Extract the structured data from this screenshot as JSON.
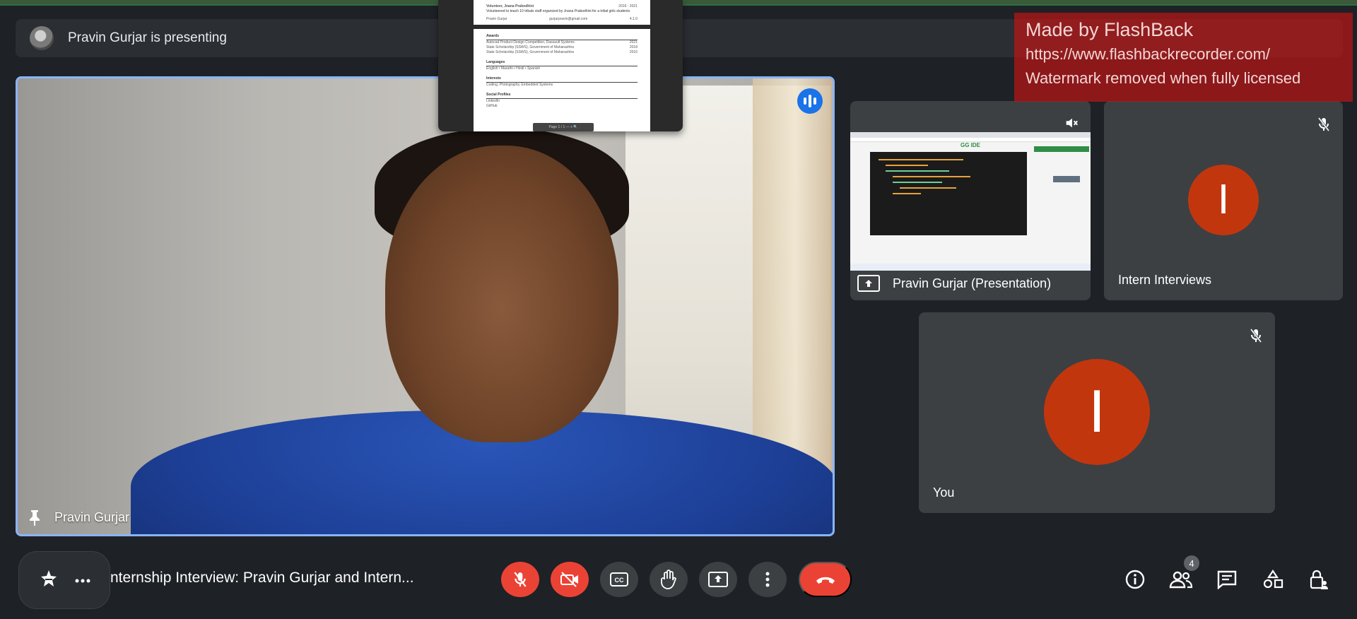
{
  "banner": {
    "text": "Pravin Gurjar is presenting"
  },
  "main_tile": {
    "name": "Pravin Gurjar"
  },
  "document_preview": {
    "activity_heading": "Volunteer, Jnana Prabodhini",
    "activity_line": "Volunteered to teach 10 tribals staff organized by Jnana Prabodhini for a tribal girls students",
    "activity_date": "2016 - 2021",
    "activity_contact": "Pravin Gurjar",
    "activity_email": "gurjarpravin@gmail.com",
    "activity_right": "4.1.0",
    "sections": [
      {
        "title": "Awards",
        "lines": [
          {
            "left": "Autocad Product Design Competition, Dassault Systems",
            "right": "2021"
          },
          {
            "left": "State Scholarship (SSWS), Government of Maharashtra",
            "right": "2018"
          },
          {
            "left": "State Scholarship (SSWS), Government of Maharashtra",
            "right": "2016"
          }
        ]
      },
      {
        "title": "Languages",
        "lines": [
          {
            "left": "English • Marathi • Hindi • Spanish",
            "right": ""
          }
        ]
      },
      {
        "title": "Interests",
        "lines": [
          {
            "left": "Coding, Photography, Embedded Systems",
            "right": ""
          }
        ]
      },
      {
        "title": "Social Profiles",
        "lines": [
          {
            "left": "LinkedIn",
            "right": ""
          },
          {
            "left": "GitHub",
            "right": ""
          }
        ]
      }
    ],
    "page_bar": "Page 1 / 1 — + 🔍"
  },
  "tiles": {
    "presentation": {
      "name": "Pravin Gurjar (Presentation)",
      "screen_logo": "GG IDE"
    },
    "intern": {
      "name": "Intern Interviews",
      "initial": "I"
    },
    "you": {
      "name": "You",
      "initial": "I"
    }
  },
  "watermark": {
    "line1": "Made by FlashBack",
    "line2": "https://www.flashbackrecorder.com/",
    "line3": "Watermark removed when fully licensed"
  },
  "meeting": {
    "title": "nternship Interview: Pravin Gurjar and Intern..."
  },
  "controls": {
    "participants_count": "4"
  },
  "colors": {
    "accent_blue": "#8ab4f8",
    "danger_red": "#ea4335",
    "avatar_orange": "#c2360e",
    "background": "#1e2126"
  }
}
